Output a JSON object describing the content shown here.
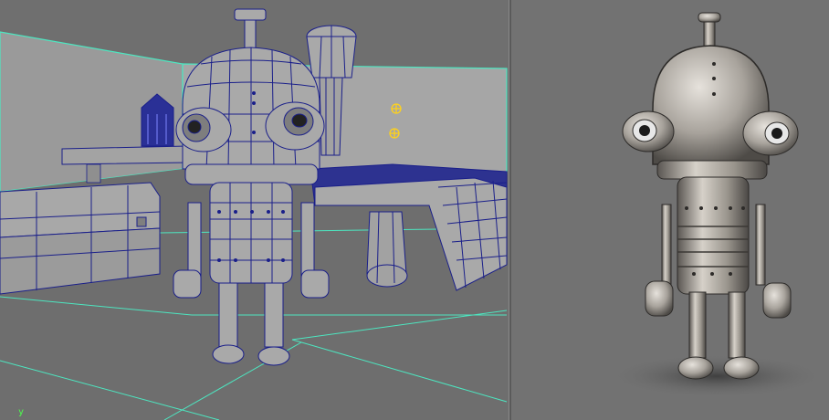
{
  "viewport": {
    "axis_label": "y",
    "wireframe_color": "#1a1f8a",
    "edge_highlight_color": "#4de6c0"
  },
  "render": {
    "subject": "robot-character"
  }
}
